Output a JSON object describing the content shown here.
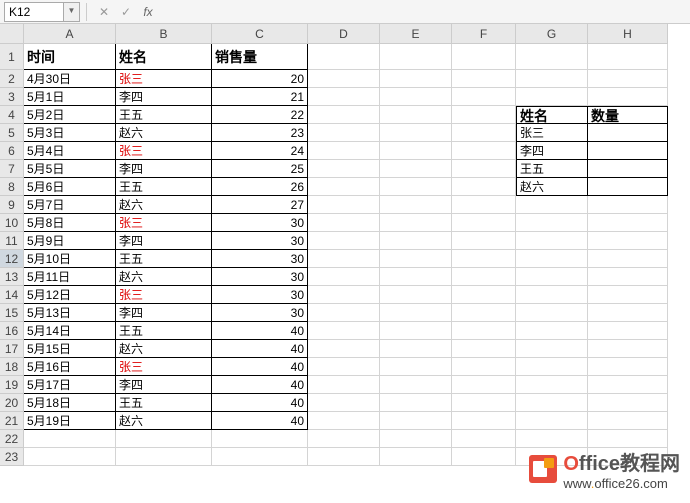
{
  "namebox": "K12",
  "formula": "",
  "colHeaders": [
    "A",
    "B",
    "C",
    "D",
    "E",
    "F",
    "G",
    "H"
  ],
  "headerRow": {
    "a": "时间",
    "b": "姓名",
    "c": "销售量"
  },
  "rows": [
    {
      "r": 2,
      "a": "4月30日",
      "b": "张三",
      "c": 20,
      "red": true
    },
    {
      "r": 3,
      "a": "5月1日",
      "b": "李四",
      "c": 21
    },
    {
      "r": 4,
      "a": "5月2日",
      "b": "王五",
      "c": 22
    },
    {
      "r": 5,
      "a": "5月3日",
      "b": "赵六",
      "c": 23
    },
    {
      "r": 6,
      "a": "5月4日",
      "b": "张三",
      "c": 24,
      "red": true
    },
    {
      "r": 7,
      "a": "5月5日",
      "b": "李四",
      "c": 25
    },
    {
      "r": 8,
      "a": "5月6日",
      "b": "王五",
      "c": 26
    },
    {
      "r": 9,
      "a": "5月7日",
      "b": "赵六",
      "c": 27
    },
    {
      "r": 10,
      "a": "5月8日",
      "b": "张三",
      "c": 30,
      "red": true
    },
    {
      "r": 11,
      "a": "5月9日",
      "b": "李四",
      "c": 30
    },
    {
      "r": 12,
      "a": "5月10日",
      "b": "王五",
      "c": 30
    },
    {
      "r": 13,
      "a": "5月11日",
      "b": "赵六",
      "c": 30
    },
    {
      "r": 14,
      "a": "5月12日",
      "b": "张三",
      "c": 30,
      "red": true
    },
    {
      "r": 15,
      "a": "5月13日",
      "b": "李四",
      "c": 30
    },
    {
      "r": 16,
      "a": "5月14日",
      "b": "王五",
      "c": 40
    },
    {
      "r": 17,
      "a": "5月15日",
      "b": "赵六",
      "c": 40
    },
    {
      "r": 18,
      "a": "5月16日",
      "b": "张三",
      "c": 40,
      "red": true
    },
    {
      "r": 19,
      "a": "5月17日",
      "b": "李四",
      "c": 40
    },
    {
      "r": 20,
      "a": "5月18日",
      "b": "王五",
      "c": 40
    },
    {
      "r": 21,
      "a": "5月19日",
      "b": "赵六",
      "c": 40
    }
  ],
  "sideTable": {
    "header": {
      "g": "姓名",
      "h": "数量"
    },
    "rows": [
      {
        "g": "张三",
        "h": ""
      },
      {
        "g": "李四",
        "h": ""
      },
      {
        "g": "王五",
        "h": ""
      },
      {
        "g": "赵六",
        "h": ""
      }
    ]
  },
  "watermark": {
    "brand_o": "O",
    "brand_rest": "ffice教程网",
    "url_pre": "www",
    "url_dot": ".",
    "url_rest": "office26.com"
  }
}
